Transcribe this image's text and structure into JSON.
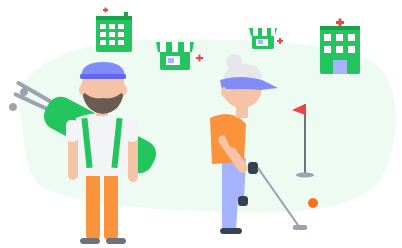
{
  "scene": {
    "description_label": "",
    "colors": {
      "background_blob": "#eefbf3",
      "building_green": "#22c55e",
      "building_dark": "#16a34a",
      "window": "#ffffff",
      "cross_red": "#ef4444",
      "flag_red": "#ef4444",
      "pole_gray": "#6b7280",
      "golf_ball_orange": "#f97316",
      "shirt_orange": "#fb923c",
      "pants_purple": "#a5b4fc",
      "visor_purple": "#818cf8",
      "hat_purple": "#818cf8",
      "skin": "#f5c4a6",
      "beard": "#6b5b52",
      "hair_gray": "#e5e7eb",
      "shirt_white": "#f3f4f6",
      "bag_green": "#22c55e",
      "shoe_gray": "#374151"
    },
    "icons": [
      "hospital-icon",
      "pharmacy-store-icon",
      "small-pharmacy-icon",
      "clinic-icon",
      "golf-flag-icon",
      "golf-ball-icon",
      "golfer-woman-icon",
      "caddie-man-icon",
      "golf-bag-icon"
    ]
  }
}
